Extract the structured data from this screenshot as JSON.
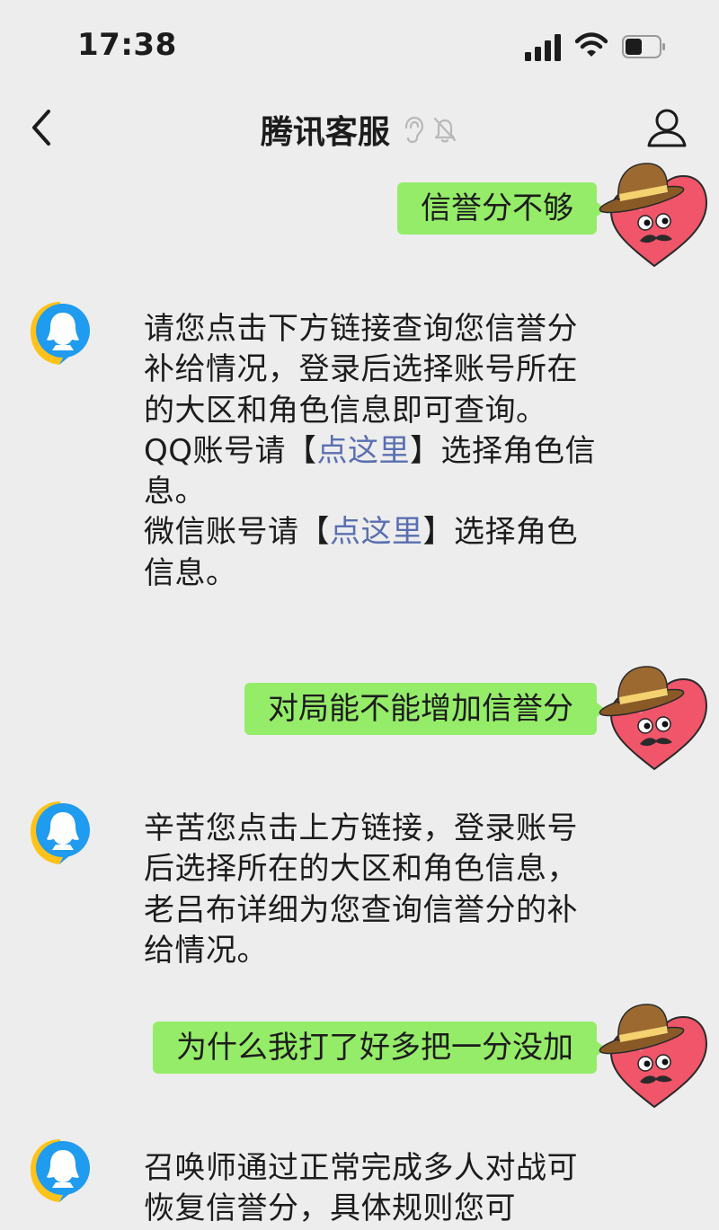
{
  "status_bar": {
    "time": "17:38"
  },
  "nav": {
    "title": "腾讯客服"
  },
  "messages": [
    {
      "text": "信誉分不够"
    },
    {
      "line1": "请您点击下方链接查询您信誉分补给情况，登录后选择账号所在的大区和角色信息即可查询。",
      "qq_prefix": "QQ账号请【",
      "qq_link": "点这里",
      "qq_suffix": "】选择角色信息。",
      "wx_prefix": "微信账号请【",
      "wx_link": "点这里",
      "wx_suffix": "】选择角色信息。"
    },
    {
      "text": "对局能不能增加信誉分"
    },
    {
      "text": "辛苦您点击上方链接，登录账号后选择所在的大区和角色信息，老吕布详细为您查询信誉分的补给情况。"
    },
    {
      "text": "为什么我打了好多把一分没加"
    },
    {
      "text": "召唤师通过正常完成多人对战可恢复信誉分，具体规则您可"
    }
  ],
  "colors": {
    "background": "#ededed",
    "outgoing_bubble": "#95ec69",
    "link": "#5a6fb0",
    "qq_blue": "#1f9bf0",
    "qq_yellow": "#ffc21a",
    "heart": "#f0556a",
    "hat": "#8a5a26"
  },
  "icons": [
    "signal-icon",
    "wifi-icon",
    "battery-icon",
    "back-arrow-icon",
    "ear-icon",
    "bell-muted-icon",
    "profile-icon",
    "qq-service-avatar-icon",
    "heart-hat-avatar-icon"
  ]
}
